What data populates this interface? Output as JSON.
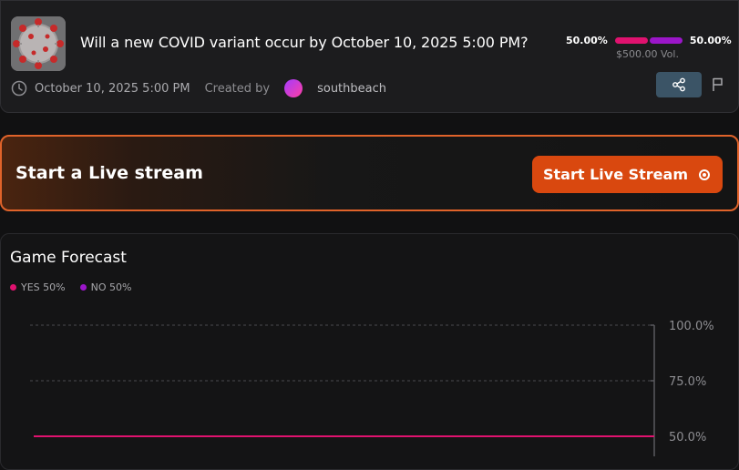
{
  "market": {
    "title": "Will a new COVID variant occur by October 10, 2025 5:00 PM?",
    "end_date": "October 10, 2025 5:00 PM",
    "created_by_label": "Created by",
    "creator": "southbeach",
    "yes_pct": "50.00%",
    "no_pct": "50.00%",
    "volume": "$500.00 Vol.",
    "yes_fraction": 0.5,
    "no_fraction": 0.5
  },
  "live": {
    "title": "Start a Live stream",
    "button_label": "Start Live Stream"
  },
  "forecast": {
    "title": "Game Forecast",
    "legend": [
      {
        "label": "YES 50%",
        "color": "#e0126f"
      },
      {
        "label": "NO 50%",
        "color": "#9b16c9"
      }
    ]
  },
  "icons": {
    "clock": "clock-icon",
    "share": "share-icon",
    "flag": "flag-icon",
    "record": "record-icon"
  },
  "colors": {
    "yes": "#e0126f",
    "no": "#9b16c9",
    "accent": "#d9480f",
    "share_bg": "#3b5466"
  },
  "chart_data": {
    "type": "line",
    "title": "",
    "xlabel": "",
    "ylabel": "",
    "y_ticks": [
      "100.0%",
      "75.0%",
      "50.0%"
    ],
    "ylim": [
      0,
      100
    ],
    "series": [
      {
        "name": "YES",
        "values": [
          50,
          50
        ]
      }
    ],
    "grid": true
  }
}
